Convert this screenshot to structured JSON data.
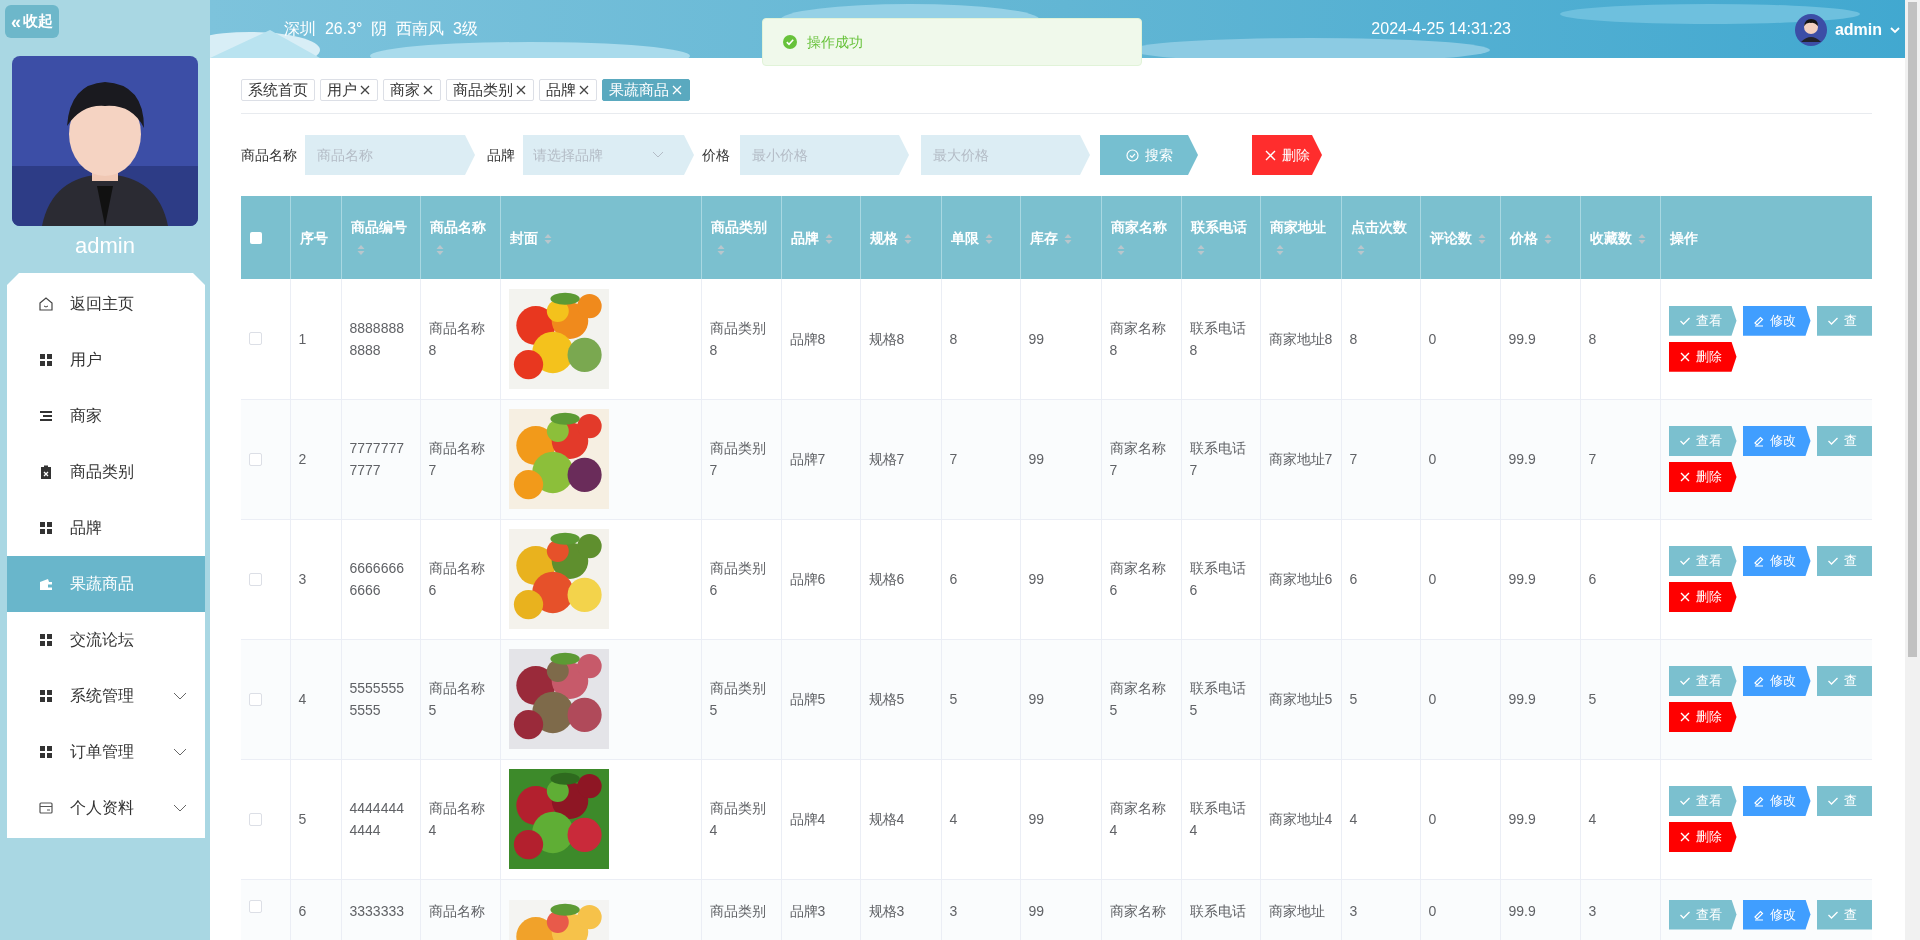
{
  "sidebar": {
    "collapse_button": {
      "icon_text": "«",
      "label": "收起"
    },
    "user_name": "admin",
    "items": [
      {
        "label": "返回主页",
        "selected": false
      },
      {
        "label": "用户",
        "selected": false
      },
      {
        "label": "商家",
        "selected": false
      },
      {
        "label": "商品类别",
        "selected": false
      },
      {
        "label": "品牌",
        "selected": false
      },
      {
        "label": "果蔬商品",
        "selected": true
      },
      {
        "label": "交流论坛",
        "selected": false
      },
      {
        "label": "系统管理",
        "selected": false,
        "expanded": false
      },
      {
        "label": "订单管理",
        "selected": false,
        "expanded": false
      },
      {
        "label": "个人资料",
        "selected": false,
        "expanded": false
      }
    ]
  },
  "header": {
    "weather": "深圳  26.3°  阴  西南风  3级",
    "datetime": "2024-4-25 14:31:23",
    "user_name": "admin"
  },
  "toast": {
    "message": "操作成功"
  },
  "tabs": [
    {
      "label": "系统首页",
      "closable": false,
      "selected": false
    },
    {
      "label": "用户",
      "closable": true,
      "selected": false
    },
    {
      "label": "商家",
      "closable": true,
      "selected": false
    },
    {
      "label": "商品类别",
      "closable": true,
      "selected": false
    },
    {
      "label": "品牌",
      "closable": true,
      "selected": false
    },
    {
      "label": "果蔬商品",
      "closable": true,
      "selected": true
    }
  ],
  "filters": {
    "name_label": "商品名称",
    "name_placeholder": "商品名称",
    "brand_label": "品牌",
    "brand_placeholder": "请选择品牌",
    "price_label": "价格",
    "min_placeholder": "最小价格",
    "max_placeholder": "最大价格",
    "search_button": "搜索",
    "delete_button": "删除"
  },
  "table": {
    "columns": [
      {
        "kind": "checkbox",
        "checked": false
      },
      {
        "kind": "text",
        "label": "序号",
        "sortable": false
      },
      {
        "kind": "text",
        "label": "商品编号",
        "sortable": true
      },
      {
        "kind": "text",
        "label": "商品名称",
        "sortable": true
      },
      {
        "kind": "picture",
        "label": "封面",
        "sortable": true
      },
      {
        "kind": "text",
        "label": "商品类别",
        "sortable": true
      },
      {
        "kind": "text",
        "label": "品牌",
        "sortable": true
      },
      {
        "kind": "text",
        "label": "规格",
        "sortable": true
      },
      {
        "kind": "text",
        "label": "单限",
        "sortable": true
      },
      {
        "kind": "text",
        "label": "库存",
        "sortable": true
      },
      {
        "kind": "text",
        "label": "商家名称",
        "sortable": true
      },
      {
        "kind": "text",
        "label": "联系电话",
        "sortable": true
      },
      {
        "kind": "text",
        "label": "商家地址",
        "sortable": true
      },
      {
        "kind": "text",
        "label": "点击次数",
        "sortable": true
      },
      {
        "kind": "text",
        "label": "评论数",
        "sortable": true
      },
      {
        "kind": "text",
        "label": "价格",
        "sortable": true
      },
      {
        "kind": "text",
        "label": "收藏数",
        "sortable": true
      },
      {
        "kind": "actions",
        "label": "操作",
        "sortable": false
      }
    ],
    "rows": [
      {
        "cells": [
          {
            "checked": false
          },
          "1",
          "88888888888",
          "商品名称8",
          {
            "kind": "picture"
          },
          "商品类别8",
          "品牌8",
          "规格8",
          "8",
          "99",
          "商家名称8",
          "联系电话8",
          "商家地址8",
          "8",
          "0",
          "99.9",
          "8",
          {
            "actions": [
              {
                "kind": "view",
                "label": "查看"
              },
              {
                "kind": "edit",
                "label": "修改"
              },
              {
                "kind": "view",
                "label": "查"
              },
              {
                "kind": "delete",
                "label": "删除"
              }
            ]
          }
        ]
      },
      {
        "cells": [
          {
            "checked": false
          },
          "2",
          "77777777777",
          "商品名称7",
          {
            "kind": "picture"
          },
          "商品类别7",
          "品牌7",
          "规格7",
          "7",
          "99",
          "商家名称7",
          "联系电话7",
          "商家地址7",
          "7",
          "0",
          "99.9",
          "7",
          {
            "actions": [
              {
                "kind": "view",
                "label": "查看"
              },
              {
                "kind": "edit",
                "label": "修改"
              },
              {
                "kind": "view",
                "label": "查"
              },
              {
                "kind": "delete",
                "label": "删除"
              }
            ]
          }
        ]
      },
      {
        "cells": [
          {
            "checked": false
          },
          "3",
          "66666666666",
          "商品名称6",
          {
            "kind": "picture"
          },
          "商品类别6",
          "品牌6",
          "规格6",
          "6",
          "99",
          "商家名称6",
          "联系电话6",
          "商家地址6",
          "6",
          "0",
          "99.9",
          "6",
          {
            "actions": [
              {
                "kind": "view",
                "label": "查看"
              },
              {
                "kind": "edit",
                "label": "修改"
              },
              {
                "kind": "view",
                "label": "查"
              },
              {
                "kind": "delete",
                "label": "删除"
              }
            ]
          }
        ]
      },
      {
        "cells": [
          {
            "checked": false
          },
          "4",
          "55555555555",
          "商品名称5",
          {
            "kind": "picture"
          },
          "商品类别5",
          "品牌5",
          "规格5",
          "5",
          "99",
          "商家名称5",
          "联系电话5",
          "商家地址5",
          "5",
          "0",
          "99.9",
          "5",
          {
            "actions": [
              {
                "kind": "view",
                "label": "查看"
              },
              {
                "kind": "edit",
                "label": "修改"
              },
              {
                "kind": "view",
                "label": "查"
              },
              {
                "kind": "delete",
                "label": "删除"
              }
            ]
          }
        ]
      },
      {
        "cells": [
          {
            "checked": false
          },
          "5",
          "44444444444",
          "商品名称4",
          {
            "kind": "picture"
          },
          "商品类别4",
          "品牌4",
          "规格4",
          "4",
          "99",
          "商家名称4",
          "联系电话4",
          "商家地址4",
          "4",
          "0",
          "99.9",
          "4",
          {
            "actions": [
              {
                "kind": "view",
                "label": "查看"
              },
              {
                "kind": "edit",
                "label": "修改"
              },
              {
                "kind": "view",
                "label": "查"
              },
              {
                "kind": "delete",
                "label": "删除"
              }
            ]
          }
        ]
      },
      {
        "cells": [
          {
            "checked": false
          },
          "6",
          "3333333",
          "商品名称",
          {
            "kind": "picture"
          },
          "商品类别",
          "品牌3",
          "规格3",
          "3",
          "99",
          "商家名称",
          "联系电话",
          "商家地址",
          "3",
          "0",
          "99.9",
          "3",
          {
            "actions": [
              {
                "kind": "view",
                "label": "查看"
              },
              {
                "kind": "edit",
                "label": "修改"
              },
              {
                "kind": "view",
                "label": "查"
              }
            ]
          }
        ]
      }
    ]
  }
}
